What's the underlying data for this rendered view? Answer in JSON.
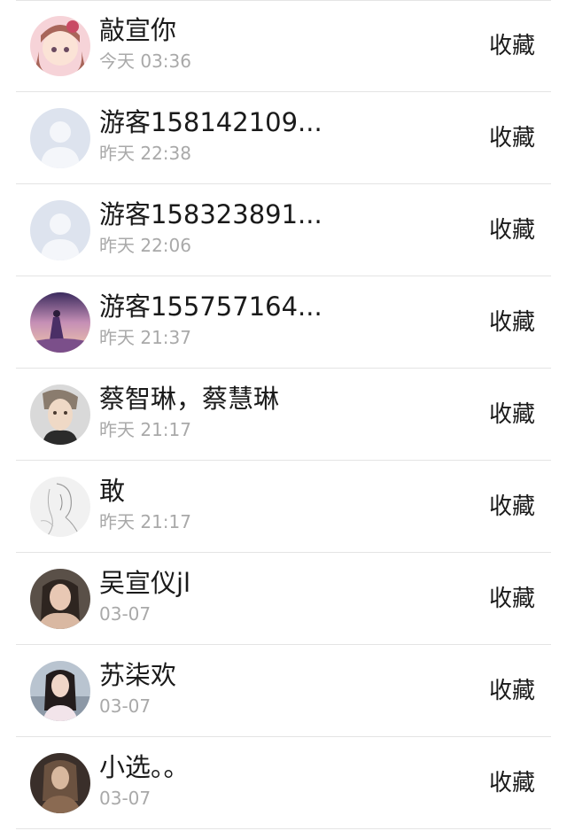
{
  "collect_label": "收藏",
  "items": [
    {
      "name": "敲宣你",
      "time": "今天 03:36",
      "avatar": "anime-girl-avatar-icon"
    },
    {
      "name": "游客158142109...",
      "time": "昨天 22:38",
      "avatar": "default-user-avatar-icon"
    },
    {
      "name": "游客158323891...",
      "time": "昨天 22:06",
      "avatar": "default-user-avatar-icon"
    },
    {
      "name": "游客155757164...",
      "time": "昨天 21:37",
      "avatar": "purple-sky-girl-avatar-icon"
    },
    {
      "name": "蔡智琳，蔡慧琳",
      "time": "昨天 21:17",
      "avatar": "male-portrait-avatar-icon"
    },
    {
      "name": "敢",
      "time": "昨天 21:17",
      "avatar": "sketch-drawing-avatar-icon"
    },
    {
      "name": "吴宣仪jl",
      "time": "03-07",
      "avatar": "woman-photo-avatar-icon"
    },
    {
      "name": "苏柒欢",
      "time": "03-07",
      "avatar": "girl-photo-avatar-icon"
    },
    {
      "name": "小选。。",
      "time": "03-07",
      "avatar": "dark-photo-avatar-icon"
    }
  ]
}
